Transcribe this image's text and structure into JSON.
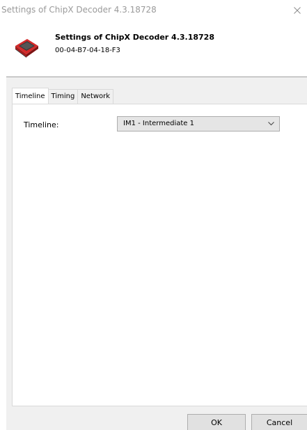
{
  "window": {
    "title": "Settings of ChipX Decoder 4.3.18728",
    "close_glyph": "×"
  },
  "header": {
    "title": "Settings of ChipX Decoder 4.3.18728",
    "subtitle": "00-04-B7-04-18-F3",
    "icon": "decoder-device-icon"
  },
  "tabs": [
    {
      "label": "Timeline",
      "active": true
    },
    {
      "label": "Timing",
      "active": false
    },
    {
      "label": "Network",
      "active": false
    }
  ],
  "timeline_tab": {
    "field_label": "Timeline:",
    "selected_value": "IM1 - Intermediate 1"
  },
  "buttons": {
    "ok_label": "OK",
    "cancel_label": "Cancel"
  },
  "colors": {
    "device_red": "#d42a2a",
    "device_dark": "#3a3a3a",
    "title_gray": "#9a9a9a"
  }
}
